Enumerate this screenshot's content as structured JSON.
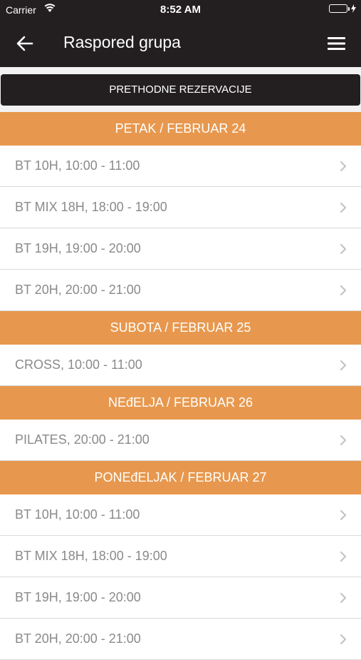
{
  "status": {
    "carrier": "Carrier",
    "time": "8:52 AM",
    "battery_level": 1.0
  },
  "header": {
    "title": "Raspored grupa",
    "back_icon": "back-arrow-icon",
    "menu_icon": "hamburger-menu-icon"
  },
  "previous_button": {
    "label": "PRETHODNE REZERVACIJE"
  },
  "colors": {
    "dark": "#231f20",
    "accent": "#e7984e"
  },
  "days": [
    {
      "label": "PETAK / FEBRUAR 24",
      "classes": [
        "BT 10H, 10:00 - 11:00",
        "BT MIX 18H, 18:00 - 19:00",
        "BT 19H, 19:00 - 20:00",
        "BT 20H, 20:00 - 21:00"
      ]
    },
    {
      "label": "SUBOTA / FEBRUAR 25",
      "classes": [
        "CROSS, 10:00 - 11:00"
      ]
    },
    {
      "label": "NEđELJA / FEBRUAR 26",
      "classes": [
        "PILATES, 20:00 - 21:00"
      ]
    },
    {
      "label": "PONEđELJAK / FEBRUAR 27",
      "classes": [
        "BT 10H, 10:00 - 11:00",
        "BT MIX 18H, 18:00 - 19:00",
        "BT 19H, 19:00 - 20:00",
        "BT 20H, 20:00 - 21:00"
      ]
    }
  ]
}
